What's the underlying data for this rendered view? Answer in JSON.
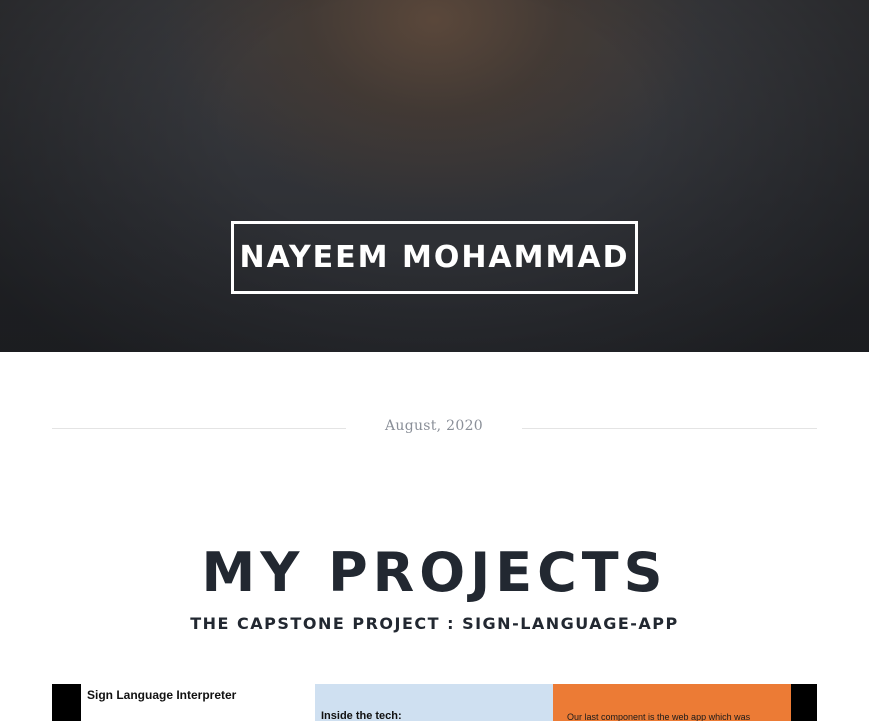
{
  "header": {
    "site_title": "NAYEEM MOHAMMAD"
  },
  "post": {
    "date": "August, 2020",
    "title": "MY PROJECTS",
    "subtitle": "THE CAPSTONE PROJECT : SIGN-LANGUAGE-APP"
  },
  "project_image": {
    "slide_title": "Sign Language Interpreter",
    "panel_blue_heading": "Inside the tech:",
    "panel_orange_text": "Our last component is the web app which was"
  },
  "colors": {
    "hero_background": "#2f3136",
    "title_text": "#222831",
    "date_text": "#8a8f98",
    "panel_blue": "#cfe0f1",
    "panel_orange": "#ec7b35"
  }
}
